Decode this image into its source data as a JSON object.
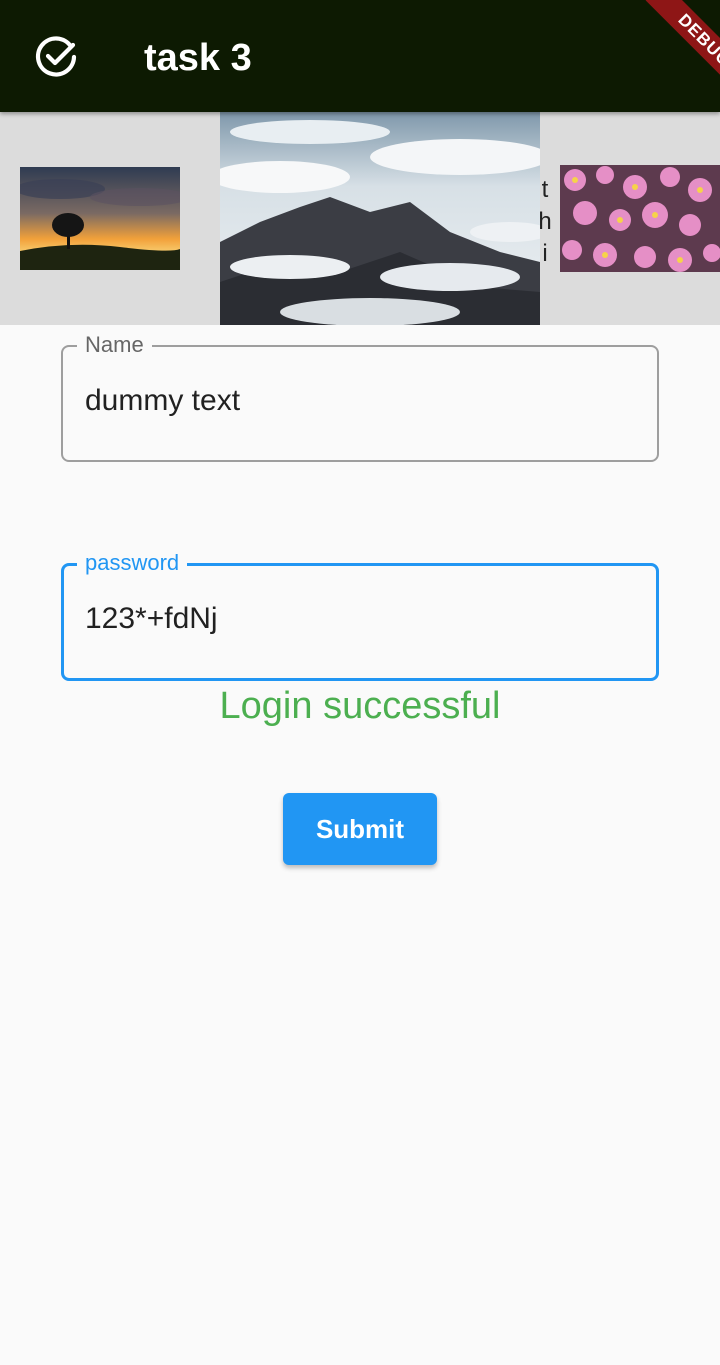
{
  "app_bar": {
    "title": "task 3",
    "leading_icon": "check-circle-icon",
    "debug_banner": "DEBUG",
    "background": "#0d1a02"
  },
  "carousel": {
    "images": [
      {
        "name": "sunset-tree-image"
      },
      {
        "name": "cloudy-mountain-image"
      },
      {
        "name": "pink-flowers-image"
      }
    ],
    "vertical_text": [
      "t",
      "h",
      "i"
    ]
  },
  "form": {
    "name_field": {
      "label": "Name",
      "value": "dummy text"
    },
    "password_field": {
      "label": "password",
      "value": "123*+fdNj"
    },
    "status_message": "Login successful",
    "submit_label": "Submit"
  },
  "colors": {
    "accent": "#2196f3",
    "success": "#4caf50",
    "banner": "#8e1616"
  }
}
